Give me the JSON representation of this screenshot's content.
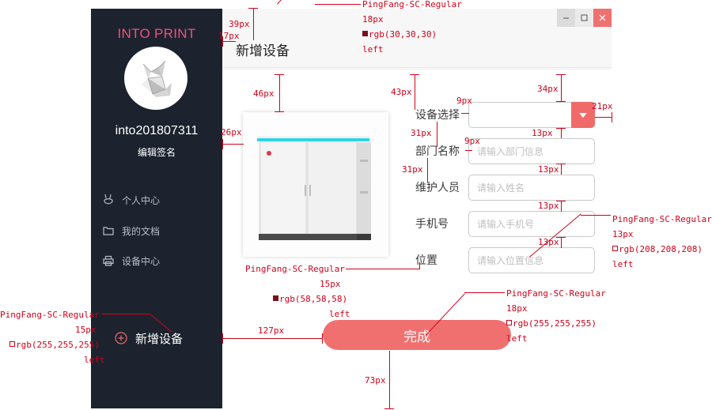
{
  "sidebar": {
    "brand": "INTO PRINT",
    "username": "into201807311",
    "signature_link": "编辑签名",
    "nav": [
      {
        "label": "个人中心",
        "icon": "rabbit-icon"
      },
      {
        "label": "我的文档",
        "icon": "folder-icon"
      },
      {
        "label": "设备中心",
        "icon": "printer-icon"
      }
    ],
    "add_device": {
      "label": "新增设备",
      "icon": "plus-circle-icon"
    }
  },
  "window": {
    "controls": [
      "minimize",
      "maximize",
      "close"
    ]
  },
  "page": {
    "title": "新增设备"
  },
  "form": {
    "device_select": {
      "label": "设备选择",
      "value": ""
    },
    "department": {
      "label": "部门名称",
      "placeholder": "请输入部门信息"
    },
    "maintainer": {
      "label": "维护人员",
      "placeholder": "请输入姓名"
    },
    "phone": {
      "label": "手机号",
      "placeholder": "请输入手机号"
    },
    "location": {
      "label": "位置",
      "placeholder": "请输入位置信息"
    },
    "submit_label": "完成"
  },
  "annotations": {
    "spec_title": [
      "PingFang-SC-Regular",
      "18px",
      "rgb(30,30,30)",
      "left"
    ],
    "spec_label": [
      "PingFang-SC-Regular",
      "15px",
      "rgb(58,58,58)",
      "left"
    ],
    "spec_placeholder": [
      "PingFang-SC-Regular",
      "13px",
      "rgb(208,208,208)",
      "left"
    ],
    "spec_button": [
      "PingFang-SC-Regular",
      "18px",
      "rgb(255,255,255)",
      "left"
    ],
    "spec_sidebar": [
      "PingFang-SC-Regular",
      "15px",
      "rgb(255,255,255)",
      "left"
    ],
    "dims": {
      "d39": "39px",
      "d17": "17px",
      "d46": "46px",
      "d26": "26px",
      "d43": "43px",
      "d34": "34px",
      "d9a": "9px",
      "d21": "21px",
      "d31a": "31px",
      "d13a": "13px",
      "d9b": "9px",
      "d31b": "31px",
      "d13b": "13px",
      "d13c": "13px",
      "d13d": "13px",
      "d127": "127px",
      "d73": "73px"
    }
  },
  "colors": {
    "sidebar_bg": "#1c232e",
    "accent": "#f07070",
    "brand": "#f0517a",
    "annotation": "#d0021b"
  }
}
